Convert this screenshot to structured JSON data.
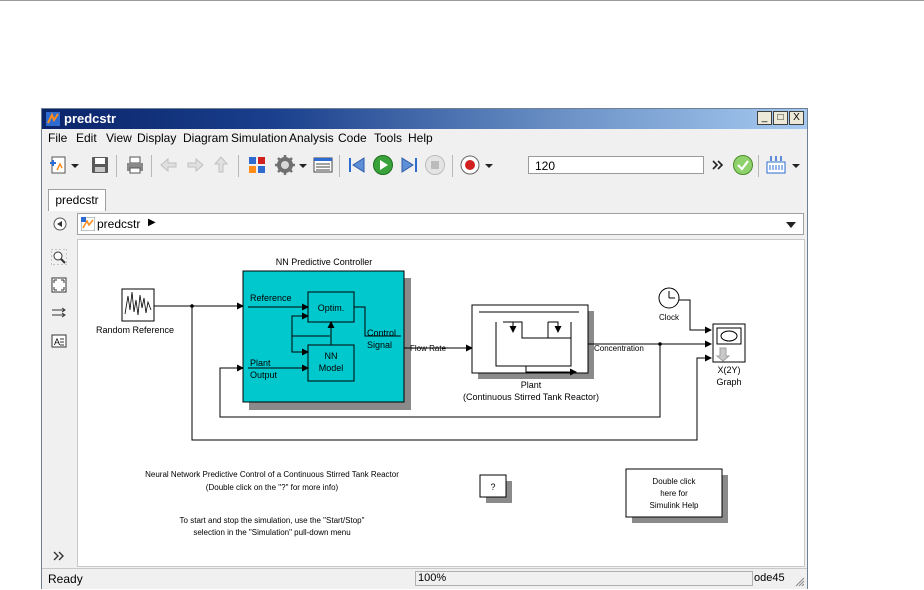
{
  "window": {
    "title": "predcstr",
    "buttons": [
      "_",
      "□",
      "X"
    ]
  },
  "menu": [
    "File",
    "Edit",
    "View",
    "Display",
    "Diagram",
    "Simulation",
    "Analysis",
    "Code",
    "Tools",
    "Help"
  ],
  "toolbar": {
    "stop_time": "120",
    "icons": [
      "new-model-icon",
      "dropdown-arrow-icon",
      "save-icon",
      "print-icon",
      "back-icon",
      "forward-icon",
      "up-icon",
      "library-browser-icon",
      "model-config-icon",
      "dropdown-arrow-icon",
      "model-explorer-icon",
      "step-back-icon",
      "run-icon",
      "step-forward-icon",
      "stop-icon",
      "record-icon",
      "dropdown-arrow-icon",
      "more-icon",
      "check-icon",
      "build-icon",
      "dropdown-arrow-icon"
    ]
  },
  "tab": {
    "label": "predcstr"
  },
  "address": {
    "path": "predcstr",
    "arrow": "▶"
  },
  "diagram": {
    "controller_title": "NN Predictive Controller",
    "reference_label": "Reference",
    "optim_label": "Optim.",
    "control_signal_1": "Control",
    "control_signal_2": "Signal",
    "nn_model_1": "NN",
    "nn_model_2": "Model",
    "plant_output_1": "Plant",
    "plant_output_2": "Output",
    "random_reference": "Random Reference",
    "flow_rate": "Flow Rate",
    "plant_label": "Plant",
    "plant_sub": "(Continuous Stirred Tank Reactor)",
    "concentration": "Concentration",
    "clock": "Clock",
    "xy_graph_1": "X(2Y)",
    "xy_graph_2": "Graph",
    "note_1": "Neural Network Predictive Control of a Continuous Stirred Tank Reactor",
    "note_2": "(Double click on the \"?\" for more info)",
    "note_3": "To start and stop the simulation, use the \"Start/Stop\"",
    "note_4": "selection in the \"Simulation\" pull-down menu",
    "help_q": "?",
    "help_box_1": "Double click",
    "help_box_2": "here for",
    "help_box_3": "Simulink Help"
  },
  "status": {
    "ready": "Ready",
    "zoom": "100%",
    "solver": "ode45"
  },
  "colors": {
    "controller_fill": "#00c8cc",
    "title_gradient_start": "#0a246a",
    "title_gradient_end": "#a6caf0"
  }
}
